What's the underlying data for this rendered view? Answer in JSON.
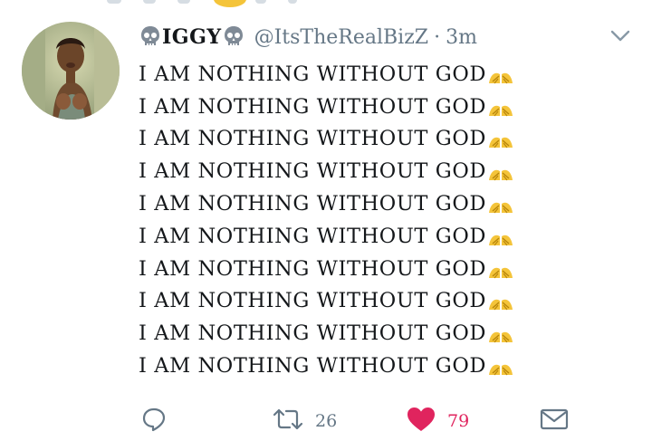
{
  "tweet": {
    "display_name": "IGGY",
    "handle": "@ItsTheRealBizZ",
    "separator": "·",
    "time": "3m",
    "lines": [
      "I AM NOTHING WITHOUT GOD",
      "I AM NOTHING WITHOUT GOD",
      "I AM NOTHING WITHOUT GOD",
      "I AM NOTHING WITHOUT GOD",
      "I AM NOTHING WITHOUT GOD",
      "I AM NOTHING WITHOUT GOD",
      "I AM NOTHING WITHOUT GOD",
      "I AM NOTHING WITHOUT GOD",
      "I AM NOTHING WITHOUT GOD",
      "I AM NOTHING WITHOUT GOD"
    ],
    "line_emoji": "folded-hands-icon",
    "name_emoji": "skull-icon"
  },
  "actions": {
    "reply_count": "",
    "retweet_count": "26",
    "like_count": "79",
    "liked": true
  },
  "colors": {
    "like": "#e0245e",
    "muted": "#657786",
    "text": "#14171a",
    "emoji": "#f4c43a"
  }
}
